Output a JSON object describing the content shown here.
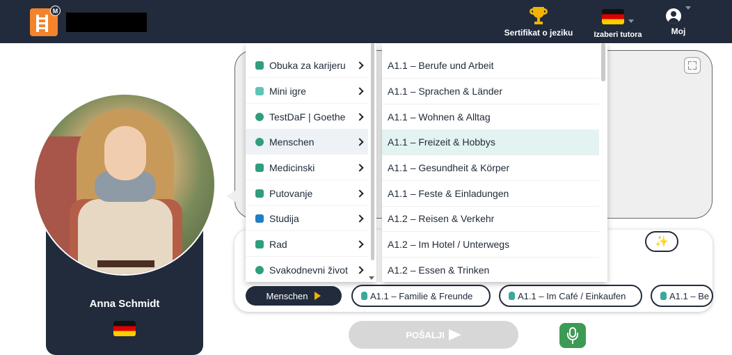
{
  "topbar": {
    "certificate_label": "Sertifikat o jeziku",
    "tutor_label": "Izaberi tutora",
    "account_label": "Moj",
    "logo_letter": "M",
    "icons": {
      "certificate": "trophy-icon",
      "tutor": "german-flag-icon",
      "account": "user-circle-icon"
    }
  },
  "tutor": {
    "name": "Anna Schmidt",
    "language_flag": "german-flag-icon"
  },
  "menu": {
    "categories": [
      {
        "label": "Obuka za karijeru",
        "icon": "career-icon",
        "color": "#2e9e7d"
      },
      {
        "label": "Mini igre",
        "icon": "games-icon",
        "color": "#5ec4b6"
      },
      {
        "label": "TestDaF | Goethe",
        "icon": "exam-icon",
        "color": "#2e9e7d"
      },
      {
        "label": "Menschen",
        "icon": "people-icon",
        "color": "#2e9e7d"
      },
      {
        "label": "Medicinski",
        "icon": "medical-icon",
        "color": "#2e9e7d"
      },
      {
        "label": "Putovanje",
        "icon": "travel-icon",
        "color": "#2e9e7d"
      },
      {
        "label": "Studija",
        "icon": "book-icon",
        "color": "#1f7ec4"
      },
      {
        "label": "Rad",
        "icon": "briefcase-icon",
        "color": "#2e9e7d"
      },
      {
        "label": "Svakodnevni život",
        "icon": "daily-life-icon",
        "color": "#2e9e7d"
      }
    ],
    "active_category": "Menschen",
    "subitems": [
      "A1.1 – Berufe und Arbeit",
      "A1.1 – Sprachen & Länder",
      "A1.1 – Wohnen & Alltag",
      "A1.1 – Freizeit & Hobbys",
      "A1.1 – Gesundheit & Körper",
      "A1.1 – Feste & Einladungen",
      "A1.2 – Reisen & Verkehr",
      "A1.2 – Im Hotel / Unterwegs",
      "A1.2 – Essen & Trinken"
    ],
    "highlighted_subitem": "A1.1 – Freizeit & Hobbys"
  },
  "input": {
    "category_pill": "Menschen",
    "topic_pills": [
      "A1.1 – Familie & Freunde",
      "A1.1 – Im Café / Einkaufen",
      "A1.1 – Be"
    ],
    "send_label": "POŠALJI"
  },
  "colors": {
    "navbar": "#222b3c",
    "accent_yellow": "#f0b400",
    "highlight_row": "#e3f3f1",
    "mic_green": "#3d9a55",
    "send_disabled": "#d7d7d7"
  }
}
